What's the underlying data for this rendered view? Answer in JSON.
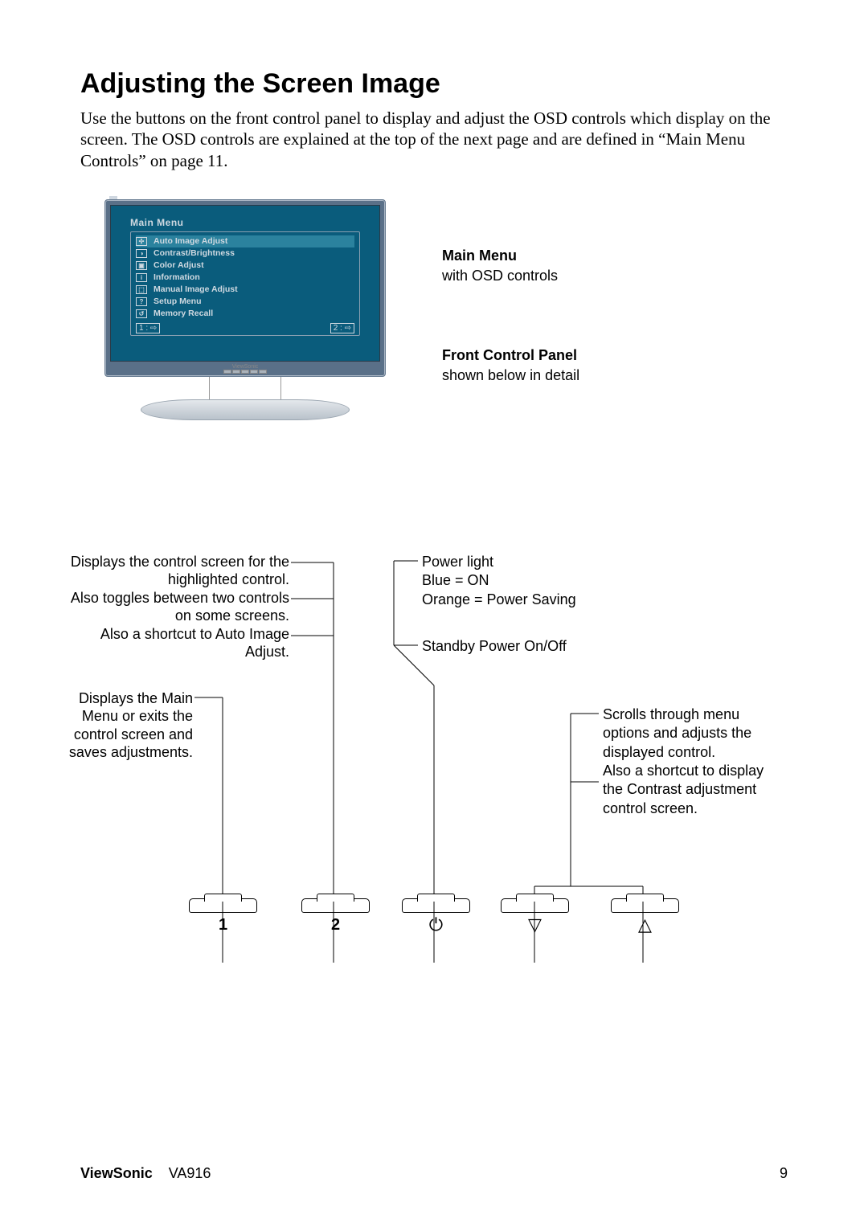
{
  "heading": "Adjusting the Screen Image",
  "intro": "Use the buttons on the front control panel to display and adjust the OSD controls which display on the screen. The OSD controls are explained at the top of the next page and are defined in “Main Menu Controls” on page 11.",
  "osd": {
    "title": "Main Menu",
    "items": [
      {
        "icon": "✣",
        "label": "Auto Image Adjust"
      },
      {
        "icon": "◑",
        "label": "Contrast/Brightness"
      },
      {
        "icon": "▣",
        "label": "Color Adjust"
      },
      {
        "icon": "i",
        "label": "Information"
      },
      {
        "icon": "⬚",
        "label": "Manual Image Adjust"
      },
      {
        "icon": "?",
        "label": "Setup Menu"
      },
      {
        "icon": "↺",
        "label": "Memory Recall"
      }
    ],
    "footer_left": "1 : ⇨",
    "footer_right": "2 : ⇨"
  },
  "monitor_brand": "ViewSonic",
  "side": {
    "main_menu_title": "Main Menu",
    "main_menu_sub": "with OSD controls",
    "panel_title": "Front Control Panel",
    "panel_sub": "shown below in detail"
  },
  "anno": {
    "btn2_a": "Displays the control screen for the highlighted control.",
    "btn2_b": "Also toggles between two controls on some screens.",
    "btn2_c": "Also a shortcut to Auto Image Adjust.",
    "btn1": "Displays the Main Menu or exits the control screen and saves adjustments.",
    "power_a": "Power light",
    "power_b": "Blue = ON",
    "power_c": "Orange = Power Saving",
    "standby": "Standby Power On/Off",
    "scroll_a": "Scrolls through menu options and adjusts the displayed control.",
    "scroll_b": "Also a shortcut to display the Contrast adjustment control screen."
  },
  "buttons": {
    "b1": "1",
    "b2": "2",
    "b3": "⏻",
    "b4": "▽",
    "b5": "△"
  },
  "footer": {
    "brand": "ViewSonic",
    "model": "VA916",
    "page": "9"
  }
}
